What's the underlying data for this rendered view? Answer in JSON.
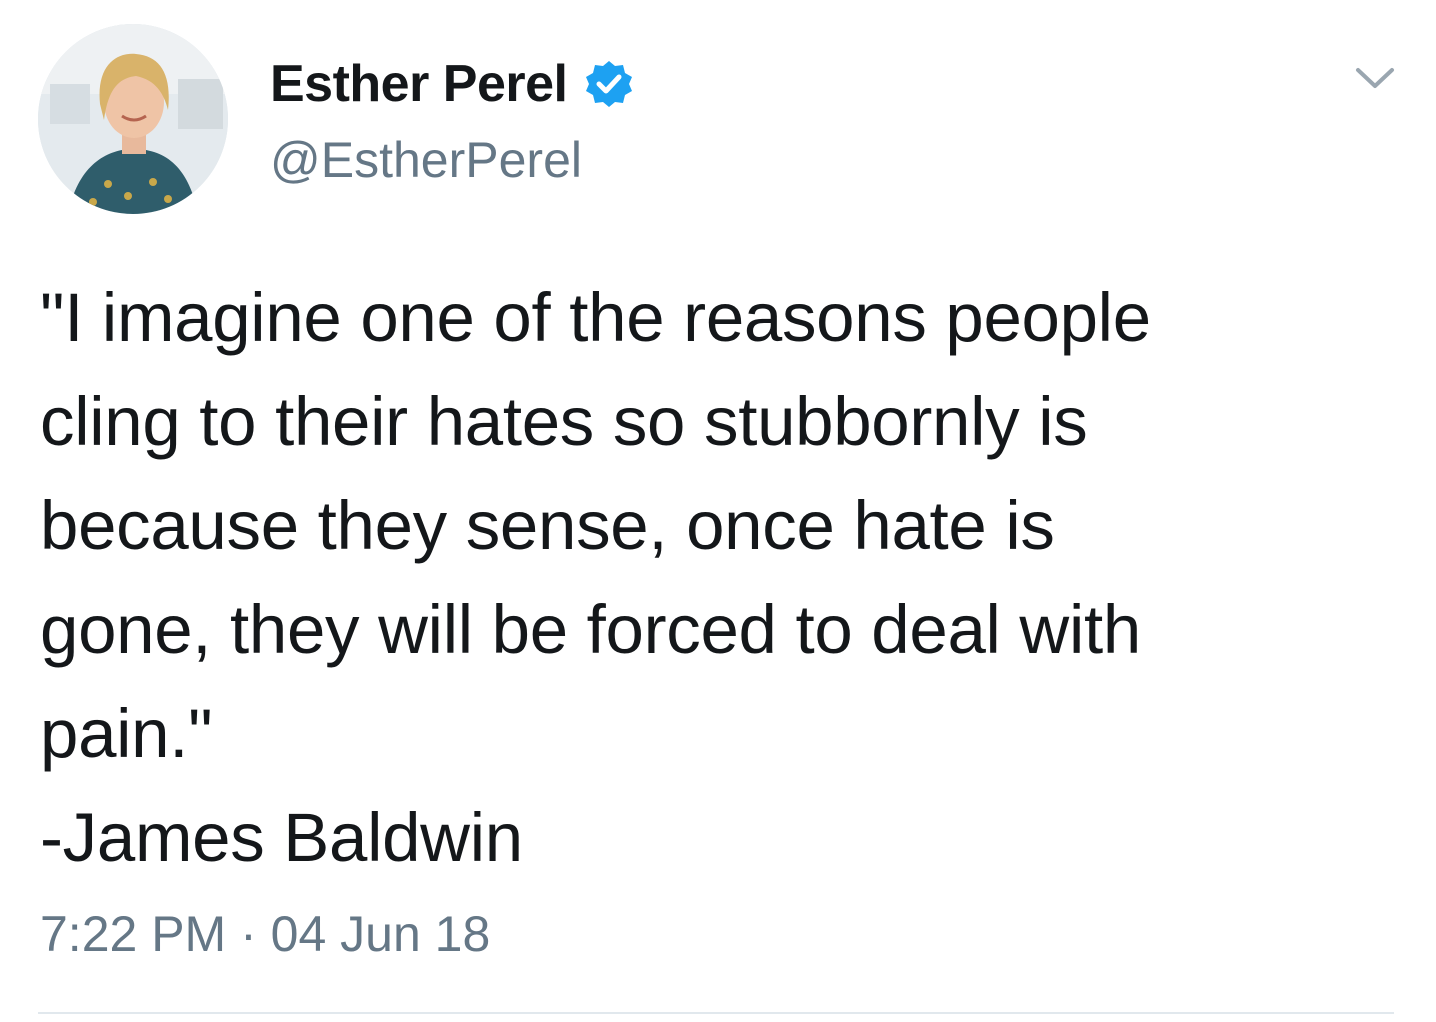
{
  "tweet": {
    "author": {
      "display_name": "Esther Perel",
      "handle": "@EstherPerel",
      "verified": true,
      "avatar_icon": "profile-photo"
    },
    "text": "\"I imagine one of the reasons people\ncling to their hates so stubbornly is\nbecause they sense, once hate is\ngone, they will be forced to deal with\npain.\"\n-James Baldwin",
    "timestamp": "7:22 PM · 04 Jun 18",
    "menu_icon": "chevron-down-icon"
  },
  "colors": {
    "text": "#14171a",
    "secondary_text": "#657786",
    "verified_blue": "#1da1f2",
    "divider": "#e1e8ed"
  }
}
